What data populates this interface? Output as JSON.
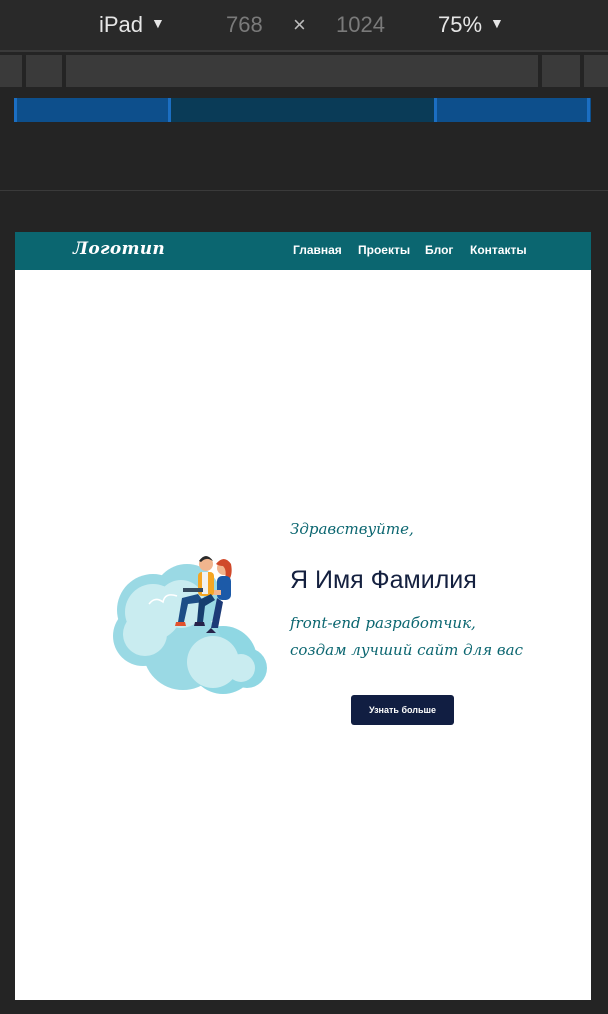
{
  "devtools": {
    "device": "iPad",
    "width": "768",
    "times": "×",
    "height": "1024",
    "zoom": "75%",
    "caret": "▼"
  },
  "site": {
    "logo": "Логотип",
    "nav": [
      "Главная",
      "Проекты",
      "Блог",
      "Контакты"
    ],
    "hero": {
      "greeting": "Здравствуйте,",
      "name": "Я Имя Фамилия",
      "role_line1": "front-end разработчик,",
      "role_line2": "создам лучший сайт для вас",
      "cta": "Узнать больше"
    }
  },
  "colors": {
    "header_bg": "#0b6670",
    "accent_text": "#0b6670",
    "name_text": "#14203f",
    "button_bg": "#111e42",
    "mq_blue": "#0d4f8c",
    "mq_dark": "#0a3b57"
  }
}
